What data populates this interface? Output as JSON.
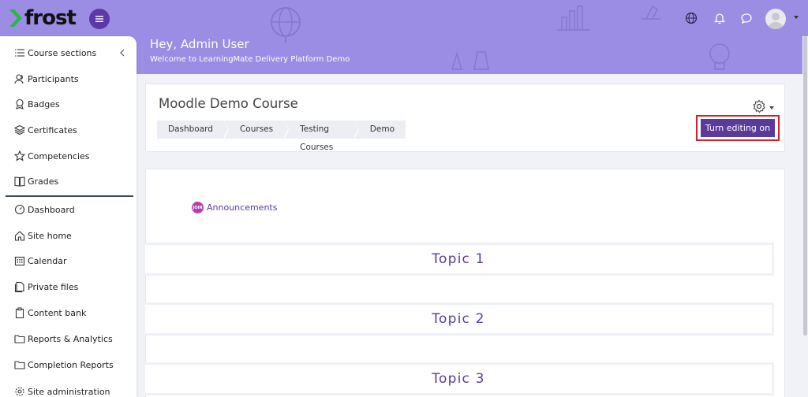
{
  "app": {
    "logo_text": "frost",
    "brand_color": "#9b8de3",
    "accent_color": "#5b3a9c"
  },
  "header": {
    "greeting": "Hey, Admin User",
    "subtitle": "Welcome to LearningMate Delivery Platform Demo",
    "icons": [
      "menu-icon",
      "globe-icon",
      "bell-icon",
      "chat-icon",
      "user-avatar"
    ]
  },
  "sidebar": {
    "items": [
      {
        "label": "Course sections",
        "icon": "list-icon"
      },
      {
        "label": "Participants",
        "icon": "users-icon"
      },
      {
        "label": "Badges",
        "icon": "badge-icon"
      },
      {
        "label": "Certificates",
        "icon": "layers-icon"
      },
      {
        "label": "Competencies",
        "icon": "star-icon"
      },
      {
        "label": "Grades",
        "icon": "book-icon"
      },
      {
        "label": "Dashboard",
        "icon": "gauge-icon"
      },
      {
        "label": "Site home",
        "icon": "home-icon"
      },
      {
        "label": "Calendar",
        "icon": "calendar-icon"
      },
      {
        "label": "Private files",
        "icon": "file-icon"
      },
      {
        "label": "Content bank",
        "icon": "clipboard-icon"
      },
      {
        "label": "Reports & Analytics",
        "icon": "folder-icon"
      },
      {
        "label": "Completion Reports",
        "icon": "folder-icon"
      },
      {
        "label": "Site administration",
        "icon": "gear-icon"
      }
    ]
  },
  "course": {
    "title": "Moodle Demo Course",
    "breadcrumbs": [
      "Dashboard",
      "Courses",
      "Testing Courses",
      "Demo"
    ],
    "edit_button": "Turn editing on"
  },
  "content": {
    "announcement_badge": "JOIN",
    "announcement": "Announcements",
    "topics": [
      "Topic 1",
      "Topic 2",
      "Topic 3"
    ]
  }
}
